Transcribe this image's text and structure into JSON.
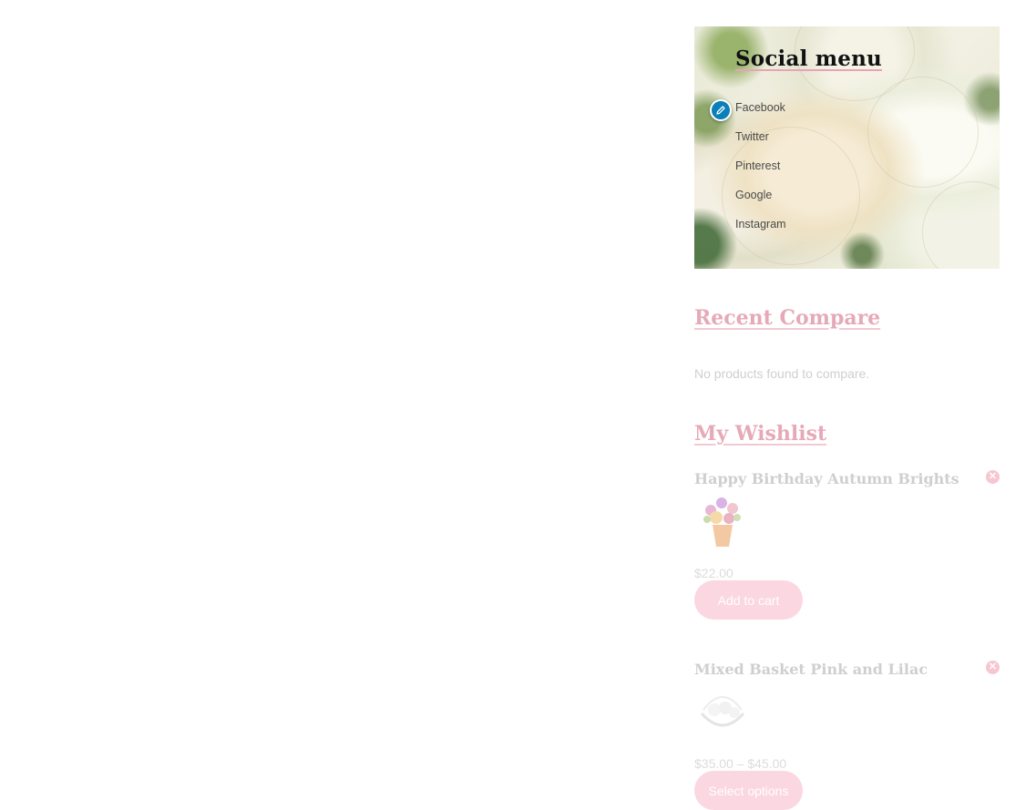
{
  "social_menu": {
    "title": "Social menu",
    "items": [
      "Facebook",
      "Twitter",
      "Pinterest",
      "Google",
      "Instagram"
    ],
    "edit_icon": "pencil-icon"
  },
  "recent_compare": {
    "title": "Recent Compare",
    "empty_text": "No products found to compare."
  },
  "wishlist": {
    "title": "My Wishlist",
    "items": [
      {
        "name": "Happy Birthday Autumn Brights",
        "price": "$22.00",
        "button": "Add to cart"
      },
      {
        "name": "Mixed Basket Pink and Lilac",
        "price": "$35.00 – $45.00",
        "button": "Select options"
      }
    ]
  },
  "colors": {
    "accent": "#e6a9b8",
    "edit_badge": "#0a7fb8",
    "button": "#fbd7e1"
  }
}
